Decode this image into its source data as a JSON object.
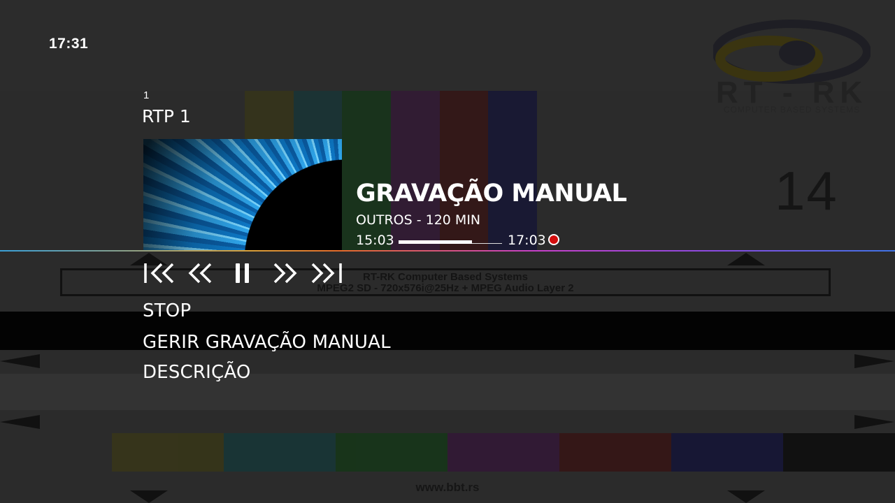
{
  "clock": "17:31",
  "channel": {
    "number": "1",
    "name": "RTP 1"
  },
  "program": {
    "title": "GRAVAÇÃO MANUAL",
    "subtitle": "OUTROS - 120 MIN",
    "start_time": "15:03",
    "end_time": "17:03",
    "progress": 0.71,
    "recording": true
  },
  "controls": [
    {
      "name": "skip-back-icon"
    },
    {
      "name": "rewind-icon"
    },
    {
      "name": "pause-icon"
    },
    {
      "name": "fast-forward-icon"
    },
    {
      "name": "skip-forward-icon"
    }
  ],
  "menu": {
    "items": [
      "STOP",
      "GERIR GRAVAÇÃO MANUAL",
      "DESCRIÇÃO"
    ],
    "selected_index": 1
  },
  "background": {
    "logo_text": "RT - RK",
    "logo_subtitle": "COMPUTER BASED SYSTEMS",
    "info_line_1": "RT-RK Computer Based Systems",
    "info_line_2": "MPEG2 SD - 720x576i@25Hz + MPEG Audio Layer 2",
    "channel_big_number": "14",
    "url": "www.bbt.rs"
  },
  "colors": {
    "recording": "#d20d0d",
    "text": "#ffffff",
    "background": "#2b2b2b"
  }
}
